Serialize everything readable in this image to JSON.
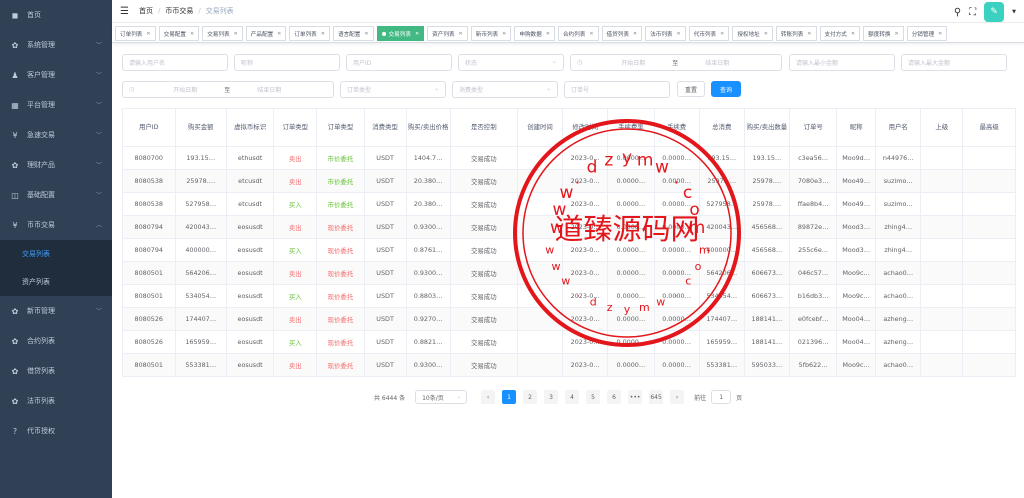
{
  "sidebar": {
    "items": [
      {
        "label": "首页",
        "icon": "dashboard-icon",
        "glyph": "◼",
        "expandable": false
      },
      {
        "label": "系统管理",
        "icon": "gear-icon",
        "glyph": "✿",
        "expandable": true
      },
      {
        "label": "客户管理",
        "icon": "user-icon",
        "glyph": "♟",
        "expandable": true
      },
      {
        "label": "平台管理",
        "icon": "grid-icon",
        "glyph": "▦",
        "expandable": true
      },
      {
        "label": "急速交易",
        "icon": "yen-icon",
        "glyph": "¥",
        "expandable": true
      },
      {
        "label": "理财产品",
        "icon": "gear-icon",
        "glyph": "✿",
        "expandable": true
      },
      {
        "label": "基础配置",
        "icon": "book-icon",
        "glyph": "◫",
        "expandable": true
      },
      {
        "label": "币币交易",
        "icon": "yen-icon",
        "glyph": "¥",
        "expandable": true,
        "expanded": true,
        "children": [
          {
            "label": "交易列表",
            "active": true
          },
          {
            "label": "资产列表",
            "active": false
          }
        ]
      },
      {
        "label": "新币管理",
        "icon": "gear-icon",
        "glyph": "✿",
        "expandable": true
      },
      {
        "label": "合约列表",
        "icon": "gear-icon",
        "glyph": "✿",
        "expandable": false
      },
      {
        "label": "借贷列表",
        "icon": "gear-icon",
        "glyph": "✿",
        "expandable": false
      },
      {
        "label": "法币列表",
        "icon": "gear-icon",
        "glyph": "✿",
        "expandable": false
      },
      {
        "label": "代币授权",
        "icon": "help-icon",
        "glyph": "?",
        "expandable": false
      }
    ]
  },
  "navbar": {
    "breadcrumb": [
      "首页",
      "币币交易",
      "交易列表"
    ],
    "avatar_glyph": "✎"
  },
  "tags": [
    {
      "label": "订单列表",
      "active": false
    },
    {
      "label": "交易配置",
      "active": false
    },
    {
      "label": "交易列表",
      "active": false
    },
    {
      "label": "产品配置",
      "active": false
    },
    {
      "label": "订单列表",
      "active": false
    },
    {
      "label": "语言配置",
      "active": false
    },
    {
      "label": "交易列表",
      "active": true
    },
    {
      "label": "资产列表",
      "active": false
    },
    {
      "label": "新币列表",
      "active": false
    },
    {
      "label": "申购数据",
      "active": false
    },
    {
      "label": "合约列表",
      "active": false
    },
    {
      "label": "借贷列表",
      "active": false
    },
    {
      "label": "法币列表",
      "active": false
    },
    {
      "label": "代币列表",
      "active": false
    },
    {
      "label": "授权地址",
      "active": false
    },
    {
      "label": "转账列表",
      "active": false
    },
    {
      "label": "支付方式",
      "active": false
    },
    {
      "label": "额度转换",
      "active": false
    },
    {
      "label": "分销管理",
      "active": false
    }
  ],
  "filters": {
    "user_name": "请输入用户名",
    "nickname": "昵称",
    "user_id": "用户ID",
    "status": "状态",
    "start_date_1": "开始日期",
    "end_date_1": "结束日期",
    "min_amount": "请输入最小金额",
    "max_amount": "请输入最大金额",
    "start_date_2": "开始日期",
    "end_date_2": "结束日期",
    "range_sep": "至",
    "order_type": "订单类型",
    "consume_type": "消费类型",
    "order_no": "订单号",
    "reset_label": "重置",
    "query_label": "查询"
  },
  "table": {
    "columns": [
      "用户ID",
      "购买金额",
      "虚拟币标识",
      "订单类型",
      "订单类型",
      "消费类型",
      "购买/卖出价格",
      "是否控制",
      "创建时间",
      "修改时间",
      "手续费率",
      "手续费",
      "总消费",
      "购买/卖出数量",
      "订单号",
      "昵称",
      "用户名",
      "上级",
      "最高级"
    ],
    "rows": [
      [
        "8080700",
        "193.15…",
        "ethusdt",
        "卖出",
        "市价委托",
        "USDT",
        "1404.7…",
        "交易成功",
        "",
        "2023-0…",
        "0.0000…",
        "0.0000…",
        "193.15…",
        "193.15…",
        "c3ea56…",
        "Moo9d…",
        "n44976…",
        "",
        ""
      ],
      [
        "8080538",
        "25978.…",
        "etcusdt",
        "卖出",
        "市价委托",
        "USDT",
        "20.380…",
        "交易成功",
        "",
        "2023-0…",
        "0.0000…",
        "0.0000…",
        "25978.…",
        "25978.…",
        "7080e3…",
        "Moo49…",
        "suzimo…",
        "",
        ""
      ],
      [
        "8080538",
        "527958…",
        "etcusdt",
        "买入",
        "市价委托",
        "USDT",
        "20.380…",
        "交易成功",
        "",
        "2023-0…",
        "0.0000…",
        "0.0000…",
        "527958…",
        "25978.…",
        "ffae8b4…",
        "Moo49…",
        "suzimo…",
        "",
        ""
      ],
      [
        "8080794",
        "420043…",
        "eosusdt",
        "卖出",
        "现价委托",
        "USDT",
        "0.9300…",
        "交易成功",
        "",
        "2023-0…",
        "0.0000…",
        "0.0000…",
        "420043…",
        "456568…",
        "89872e…",
        "Mood3…",
        "zhing4…",
        "",
        ""
      ],
      [
        "8080794",
        "400000…",
        "eosusdt",
        "买入",
        "现价委托",
        "USDT",
        "0.8761…",
        "交易成功",
        "",
        "2023-0…",
        "0.0000…",
        "0.0000…",
        "400000…",
        "456568…",
        "255c6e…",
        "Mood3…",
        "zhing4…",
        "",
        ""
      ],
      [
        "8080501",
        "564206…",
        "eosusdt",
        "卖出",
        "现价委托",
        "USDT",
        "0.9300…",
        "交易成功",
        "",
        "2023-0…",
        "0.0000…",
        "0.0000…",
        "564206…",
        "606673…",
        "046c57…",
        "Moo9c…",
        "achao0…",
        "",
        ""
      ],
      [
        "8080501",
        "534054…",
        "eosusdt",
        "买入",
        "现价委托",
        "USDT",
        "0.8803…",
        "交易成功",
        "",
        "2023-0…",
        "0.0000…",
        "0.0000…",
        "534054…",
        "606673…",
        "b16db3…",
        "Moo9c…",
        "achao0…",
        "",
        ""
      ],
      [
        "8080526",
        "174407…",
        "eosusdt",
        "卖出",
        "现价委托",
        "USDT",
        "0.9270…",
        "交易成功",
        "",
        "2023-0…",
        "0.0000…",
        "0.0000…",
        "174407…",
        "188141…",
        "e0fcebf…",
        "Moo04…",
        "azheng…",
        "",
        ""
      ],
      [
        "8080526",
        "165959…",
        "eosusdt",
        "买入",
        "现价委托",
        "USDT",
        "0.8821…",
        "交易成功",
        "",
        "2023-0…",
        "0.0000…",
        "0.0000…",
        "165959…",
        "188141…",
        "021396…",
        "Moo04…",
        "azheng…",
        "",
        ""
      ],
      [
        "8080501",
        "553381…",
        "eosusdt",
        "卖出",
        "现价委托",
        "USDT",
        "0.9300…",
        "交易成功",
        "",
        "2023-0…",
        "0.0000…",
        "0.0000…",
        "553381…",
        "595033…",
        "5fb622…",
        "Moo9c…",
        "achao0…",
        "",
        ""
      ]
    ]
  },
  "pagination": {
    "total": "共 6444 条",
    "page_size": "10条/页",
    "prev": "‹",
    "next": "›",
    "pages": [
      "1",
      "2",
      "3",
      "4",
      "5",
      "6",
      "•••",
      "645"
    ],
    "active_page": "1",
    "goto_label": "前往",
    "goto_value": "1",
    "page_unit": "页"
  },
  "watermark": {
    "text": "道臻源码网",
    "url_glyphs": [
      "w",
      "w",
      "w",
      ".",
      "d",
      "z",
      "y",
      "m",
      "w",
      ".",
      "c",
      "o",
      "m"
    ],
    "url_glyphs_bottom": [
      "w",
      "w",
      "w",
      ".",
      "d",
      "z",
      "y",
      "m",
      "w",
      ".",
      "c",
      "o",
      "m"
    ],
    "color": "#e3161b"
  },
  "colors": {
    "sidebar_bg": "#304156",
    "accent": "#1890ff",
    "active_tag": "#42b983",
    "sell": "#f56c6c",
    "buy": "#67c23a"
  }
}
